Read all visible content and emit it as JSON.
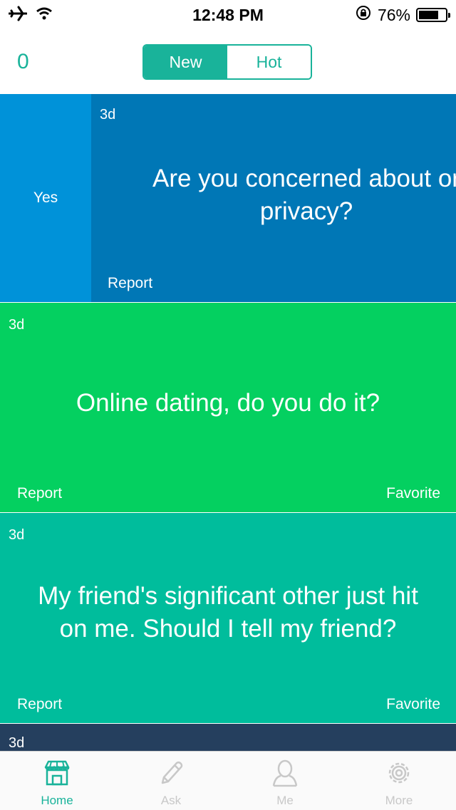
{
  "status_bar": {
    "time": "12:48 PM",
    "battery_percent": "76%",
    "battery_level": 0.76,
    "icons": [
      "airplane-icon",
      "wifi-icon",
      "rotation-lock-icon",
      "battery-icon"
    ]
  },
  "nav": {
    "score": "0",
    "tabs": [
      {
        "label": "New",
        "selected": true
      },
      {
        "label": "Hot",
        "selected": false
      }
    ]
  },
  "colors": {
    "accent": "#19b39a",
    "card1": "#0077b6",
    "card1_yes": "#0092d9",
    "card2": "#04d060",
    "card3": "#00bd9c",
    "card4": "#253f5e"
  },
  "cards": [
    {
      "age": "3d",
      "question": "Are you concerned about or privacy?",
      "swipe_label": "Yes",
      "report": "Report",
      "favorite": ""
    },
    {
      "age": "3d",
      "question": "Online dating, do you do it?",
      "report": "Report",
      "favorite": "Favorite"
    },
    {
      "age": "3d",
      "question": "My friend's significant other just hit on me. Should I tell my friend?",
      "report": "Report",
      "favorite": "Favorite"
    },
    {
      "age": "3d"
    }
  ],
  "card1_lines": [
    "Are you concerned about or",
    "privacy?"
  ],
  "card3_lines": [
    "My friend's significant other just hit",
    "on me. Should I tell my friend?"
  ],
  "tab_bar": [
    {
      "label": "Home",
      "icon": "store-icon",
      "active": true
    },
    {
      "label": "Ask",
      "icon": "pencil-icon",
      "active": false
    },
    {
      "label": "Me",
      "icon": "person-icon",
      "active": false
    },
    {
      "label": "More",
      "icon": "gear-icon",
      "active": false
    }
  ]
}
